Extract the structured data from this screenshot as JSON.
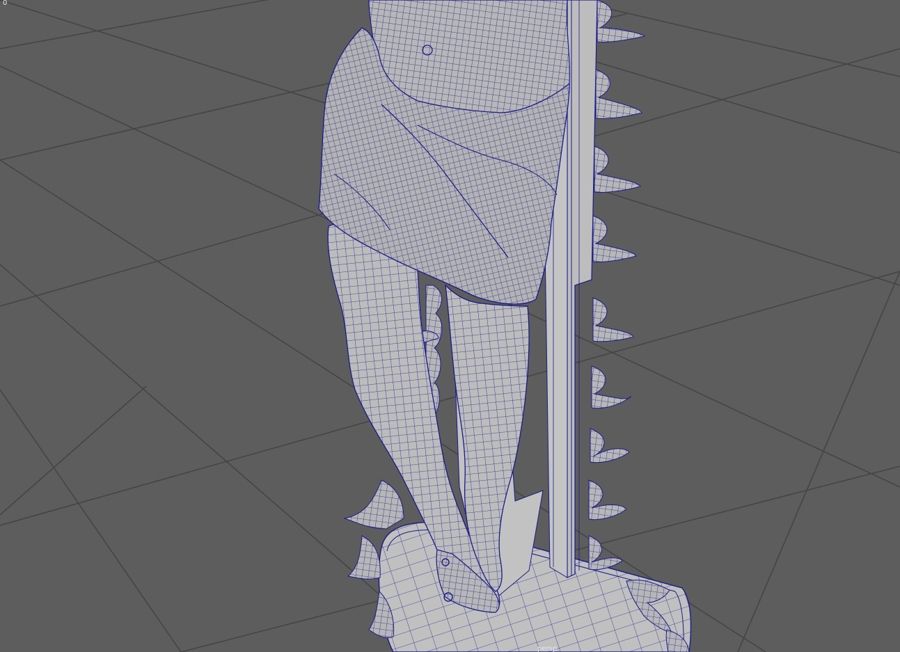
{
  "viewport": {
    "frame_counter": "0",
    "camera_name": "persp",
    "background_color": "#5d5d5d",
    "grid_color": "#3f3f3f",
    "mesh_fill_color": "#b9b9b9",
    "wireframe_color": "#1a1a8c"
  },
  "scene": {
    "model": "statue-on-pedestal",
    "display_mode": "shaded-wireframe"
  }
}
